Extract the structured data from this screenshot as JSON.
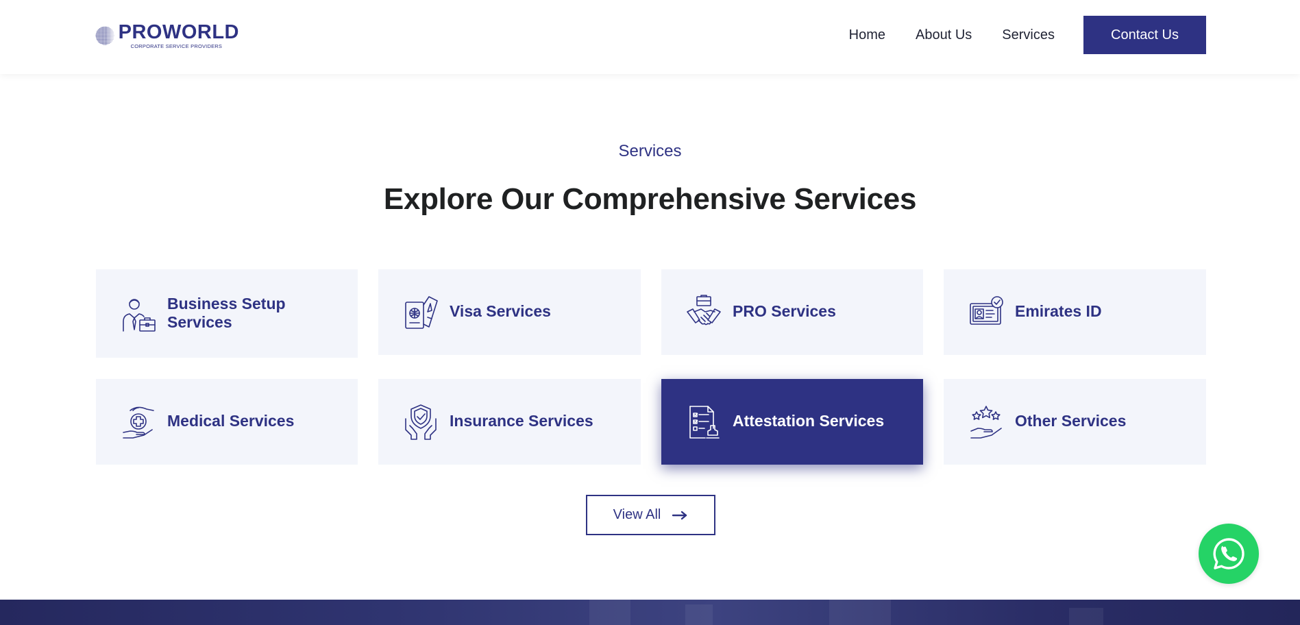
{
  "brand": {
    "name": "PROWORLD",
    "tagline": "CORPORATE SERVICE PROVIDERS"
  },
  "nav": {
    "items": [
      "Home",
      "About Us",
      "Services"
    ],
    "contact_label": "Contact Us"
  },
  "section": {
    "eyebrow": "Services",
    "title": "Explore Our Comprehensive Services"
  },
  "services": [
    {
      "label_line1": "Business Setup",
      "label_line2": "Services",
      "icon": "businessman-briefcase-icon"
    },
    {
      "label": "Visa Services",
      "icon": "passport-icon"
    },
    {
      "label": "PRO Services",
      "icon": "handshake-icon"
    },
    {
      "label": "Emirates ID",
      "icon": "id-card-icon"
    },
    {
      "label": "Medical Services",
      "icon": "medical-hand-icon"
    },
    {
      "label": "Insurance Services",
      "icon": "shield-hands-icon"
    },
    {
      "label": "Attestation Services",
      "icon": "document-stamp-icon",
      "active": true
    },
    {
      "label": "Other Services",
      "icon": "stars-hand-icon"
    }
  ],
  "view_all_label": "View All",
  "colors": {
    "brand": "#2e3283",
    "card_bg": "#f3f5fb",
    "whatsapp": "#25d366",
    "heading": "#1f2122"
  }
}
